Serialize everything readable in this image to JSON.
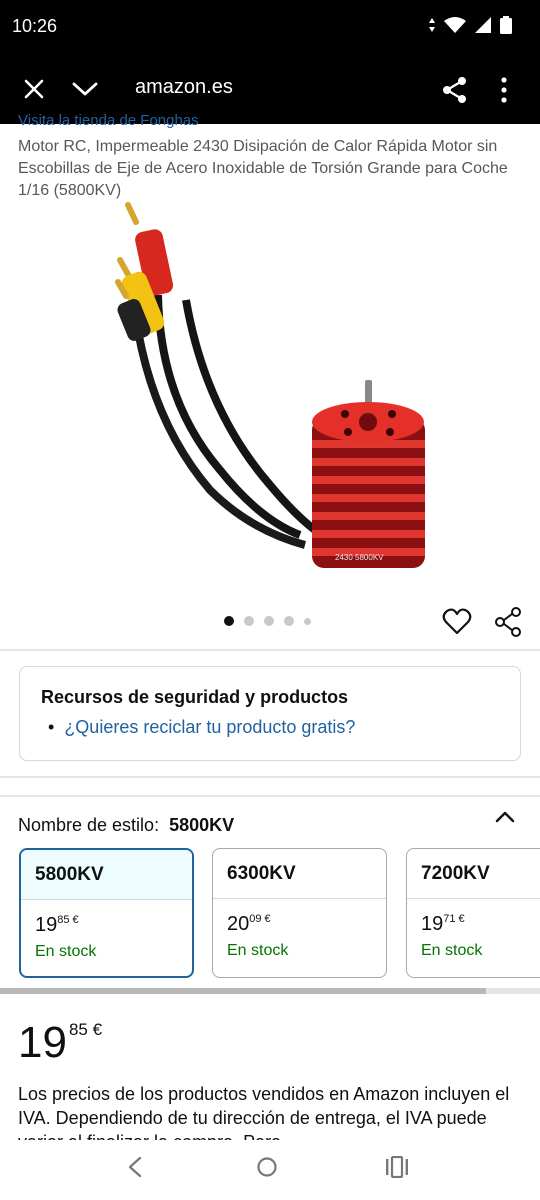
{
  "status_bar": {
    "time": "10:26"
  },
  "browser": {
    "url": "amazon.es"
  },
  "product": {
    "store_link": "Visita la tienda de Fonghas",
    "title": "Motor RC, Impermeable 2430 Disipación de Calor Rápida Motor sin Escobillas de Eje de Acero Inoxidable de Torsión Grande para Coche 1/16 (5800KV)",
    "motor_label": "2430 5800KV",
    "image_count": 5,
    "active_image": 1
  },
  "safety": {
    "title": "Recursos de seguridad y productos",
    "link": "¿Quieres reciclar tu producto gratis?"
  },
  "style": {
    "label": "Nombre de estilo:",
    "selected": "5800KV",
    "options": [
      {
        "name": "5800KV",
        "price_int": "19",
        "price_dec": "85 €",
        "stock": "En stock"
      },
      {
        "name": "6300KV",
        "price_int": "20",
        "price_dec": "09 €",
        "stock": "En stock"
      },
      {
        "name": "7200KV",
        "price_int": "19",
        "price_dec": "71 €",
        "stock": "En stock"
      }
    ]
  },
  "price": {
    "integer": "19",
    "decimal": "85 €"
  },
  "tax_note": "Los precios de los productos vendidos en Amazon incluyen el IVA. Dependiendo de tu dirección de entrega, el IVA puede variar al finalizar la compra. Para"
}
